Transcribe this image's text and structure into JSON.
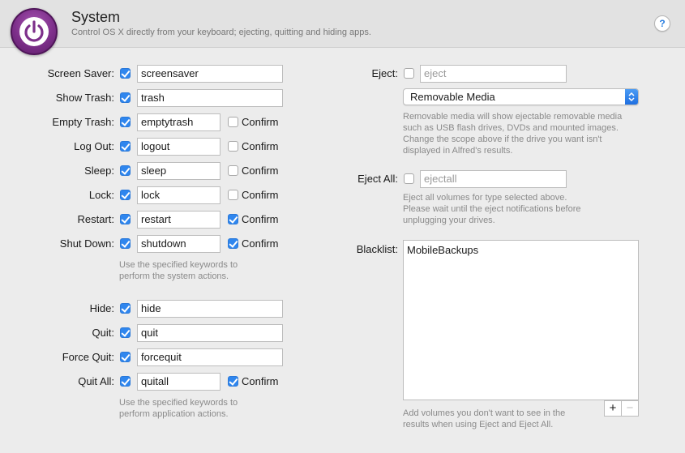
{
  "header": {
    "title": "System",
    "subtitle": "Control OS X directly from your keyboard; ejecting, quitting and hiding apps.",
    "help_label": "?"
  },
  "system_actions": [
    {
      "label": "Screen Saver:",
      "enabled": true,
      "keyword": "screensaver",
      "has_confirm": false
    },
    {
      "label": "Show Trash:",
      "enabled": true,
      "keyword": "trash",
      "has_confirm": false
    },
    {
      "label": "Empty Trash:",
      "enabled": true,
      "keyword": "emptytrash",
      "has_confirm": true,
      "confirm": false
    },
    {
      "label": "Log Out:",
      "enabled": true,
      "keyword": "logout",
      "has_confirm": true,
      "confirm": false
    },
    {
      "label": "Sleep:",
      "enabled": true,
      "keyword": "sleep",
      "has_confirm": true,
      "confirm": false
    },
    {
      "label": "Lock:",
      "enabled": true,
      "keyword": "lock",
      "has_confirm": true,
      "confirm": false
    },
    {
      "label": "Restart:",
      "enabled": true,
      "keyword": "restart",
      "has_confirm": true,
      "confirm": true
    },
    {
      "label": "Shut Down:",
      "enabled": true,
      "keyword": "shutdown",
      "has_confirm": true,
      "confirm": true
    }
  ],
  "system_hint": [
    "Use the specified keywords to",
    "perform the system actions."
  ],
  "app_actions": [
    {
      "label": "Hide:",
      "enabled": true,
      "keyword": "hide",
      "has_confirm": false
    },
    {
      "label": "Quit:",
      "enabled": true,
      "keyword": "quit",
      "has_confirm": false
    },
    {
      "label": "Force Quit:",
      "enabled": true,
      "keyword": "forcequit",
      "has_confirm": false
    },
    {
      "label": "Quit All:",
      "enabled": true,
      "keyword": "quitall",
      "has_confirm": true,
      "confirm": true
    }
  ],
  "app_hint": [
    "Use the specified keywords to",
    "perform application actions."
  ],
  "confirm_label": "Confirm",
  "eject": {
    "label": "Eject:",
    "enabled": false,
    "keyword": "eject",
    "scope_selected": "Removable Media",
    "hint": [
      "Removable media will show ejectable removable media",
      "such as USB flash drives, DVDs and mounted images.",
      "Change the scope above if the drive you want isn't",
      "displayed in Alfred's results."
    ]
  },
  "eject_all": {
    "label": "Eject All:",
    "enabled": false,
    "keyword": "ejectall",
    "hint": [
      "Eject all volumes for type selected above.",
      "Please wait until the eject notifications before",
      "unplugging your drives."
    ]
  },
  "blacklist": {
    "label": "Blacklist:",
    "items": [
      "MobileBackups"
    ],
    "add_label": "+",
    "remove_label": "−",
    "hint": [
      "Add volumes you don't want to see in the",
      "results when using Eject and Eject All."
    ]
  },
  "colors": {
    "accent": "#2f86ee",
    "icon_purple": "#7d2f8a"
  }
}
